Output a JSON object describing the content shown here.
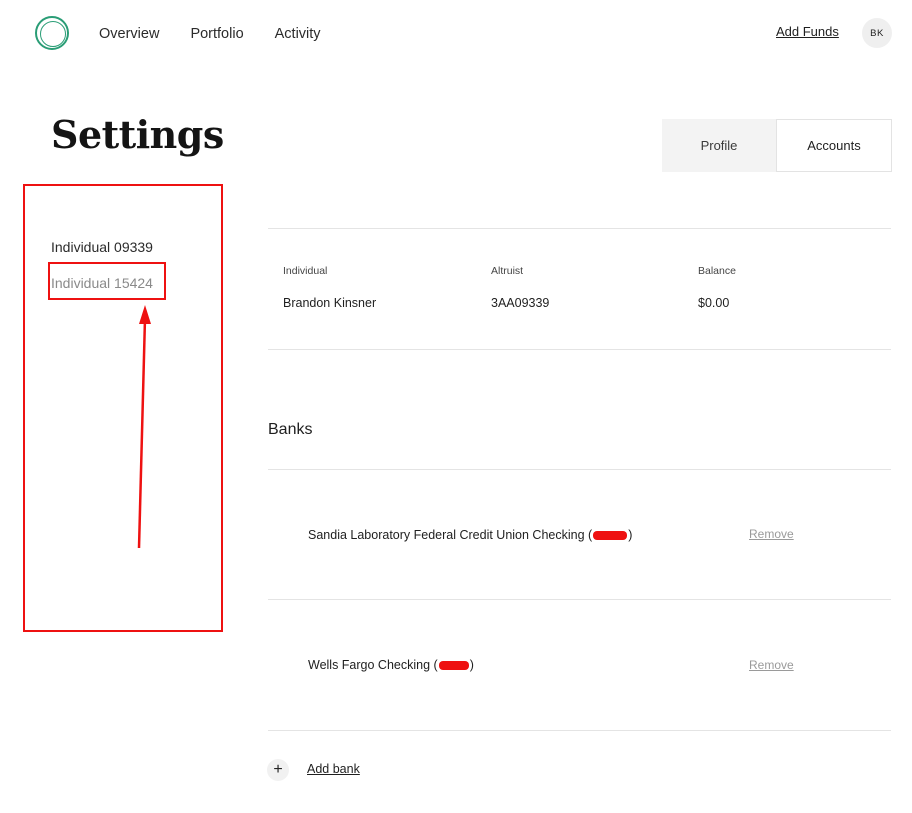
{
  "header": {
    "nav": [
      "Overview",
      "Portfolio",
      "Activity"
    ],
    "add_funds": "Add Funds",
    "avatar_initials": "BK"
  },
  "page": {
    "title": "Settings"
  },
  "tabs": [
    {
      "label": "Profile",
      "active": false
    },
    {
      "label": "Accounts",
      "active": true
    }
  ],
  "sidebar": {
    "items": [
      {
        "label": "Individual 09339"
      },
      {
        "label": "Individual 15424"
      }
    ]
  },
  "account": {
    "headers": [
      "Individual",
      "Altruist",
      "Balance"
    ],
    "values": [
      "Brandon Kinsner",
      "3AA09339",
      "$0.00"
    ]
  },
  "banks": {
    "heading": "Banks",
    "items": [
      {
        "name": "Sandia Laboratory Federal Credit Union Checking",
        "remove_label": "Remove"
      },
      {
        "name": "Wells Fargo Checking",
        "remove_label": "Remove"
      }
    ],
    "add_label": "Add bank",
    "add_icon": "plus-icon"
  },
  "colors": {
    "brand_green": "#2a9d76",
    "annotation_red": "#ee1111"
  }
}
